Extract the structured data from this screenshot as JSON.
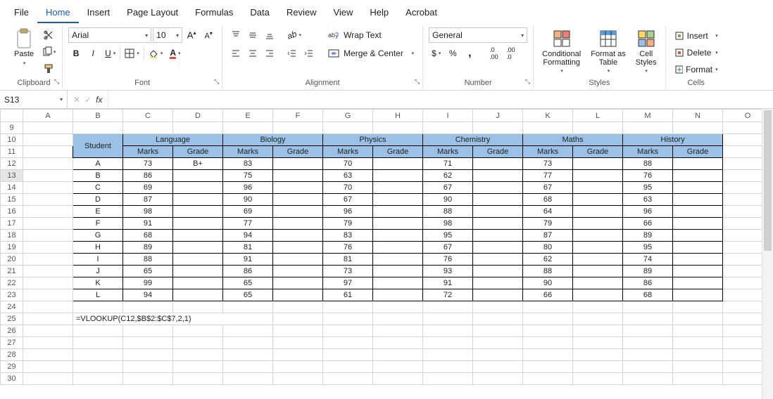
{
  "tabs": [
    "File",
    "Home",
    "Insert",
    "Page Layout",
    "Formulas",
    "Data",
    "Review",
    "View",
    "Help",
    "Acrobat"
  ],
  "active_tab": "Home",
  "ribbon": {
    "clipboard": {
      "label": "Clipboard",
      "paste": "Paste"
    },
    "font": {
      "label": "Font",
      "name": "Arial",
      "size": "10",
      "bold": "B",
      "italic": "I",
      "underline": "U"
    },
    "alignment": {
      "label": "Alignment",
      "wrap": "Wrap Text",
      "merge": "Merge & Center"
    },
    "number": {
      "label": "Number",
      "format": "General"
    },
    "styles": {
      "label": "Styles",
      "cond": "Conditional\nFormatting",
      "table": "Format as\nTable",
      "cell": "Cell\nStyles"
    },
    "cells": {
      "label": "Cells",
      "insert": "Insert",
      "delete": "Delete",
      "format": "Format"
    }
  },
  "namebox": "S13",
  "formula": "",
  "columns": [
    "A",
    "B",
    "C",
    "D",
    "E",
    "F",
    "G",
    "H",
    "I",
    "J",
    "K",
    "L",
    "M",
    "N",
    "O"
  ],
  "row_start": 9,
  "row_end": 30,
  "table": {
    "header_row": 10,
    "subheader_row": 11,
    "student_label": "Student",
    "subjects": [
      "Language",
      "Biology",
      "Physics",
      "Chemistry",
      "Maths",
      "History"
    ],
    "sub_labels": [
      "Marks",
      "Grade"
    ],
    "students": [
      "A",
      "B",
      "C",
      "D",
      "E",
      "F",
      "G",
      "H",
      "I",
      "J",
      "K",
      "L"
    ],
    "data": {
      "Language": {
        "marks": [
          73,
          86,
          69,
          87,
          98,
          91,
          68,
          89,
          88,
          65,
          99,
          94
        ],
        "grade": [
          "B+",
          "",
          "",
          "",
          "",
          "",
          "",
          "",
          "",
          "",
          "",
          ""
        ]
      },
      "Biology": {
        "marks": [
          83,
          75,
          96,
          90,
          69,
          77,
          94,
          81,
          91,
          86,
          65,
          65
        ],
        "grade": [
          "",
          "",
          "",
          "",
          "",
          "",
          "",
          "",
          "",
          "",
          "",
          ""
        ]
      },
      "Physics": {
        "marks": [
          70,
          63,
          70,
          67,
          96,
          79,
          83,
          76,
          81,
          73,
          97,
          61
        ],
        "grade": [
          "",
          "",
          "",
          "",
          "",
          "",
          "",
          "",
          "",
          "",
          "",
          ""
        ]
      },
      "Chemistry": {
        "marks": [
          71,
          62,
          67,
          90,
          88,
          98,
          95,
          67,
          76,
          93,
          91,
          72
        ],
        "grade": [
          "",
          "",
          "",
          "",
          "",
          "",
          "",
          "",
          "",
          "",
          "",
          ""
        ]
      },
      "Maths": {
        "marks": [
          73,
          77,
          67,
          68,
          64,
          79,
          87,
          80,
          62,
          88,
          90,
          66
        ],
        "grade": [
          "",
          "",
          "",
          "",
          "",
          "",
          "",
          "",
          "",
          "",
          "",
          ""
        ]
      },
      "History": {
        "marks": [
          88,
          76,
          95,
          63,
          96,
          66,
          89,
          95,
          74,
          89,
          86,
          68
        ],
        "grade": [
          "",
          "",
          "",
          "",
          "",
          "",
          "",
          "",
          "",
          "",
          "",
          ""
        ]
      }
    },
    "formula_cell": {
      "row": 25,
      "col": "B",
      "text": "=VLOOKUP(C12,$B$2:$C$7,2,1)"
    }
  },
  "selected_row": 13
}
